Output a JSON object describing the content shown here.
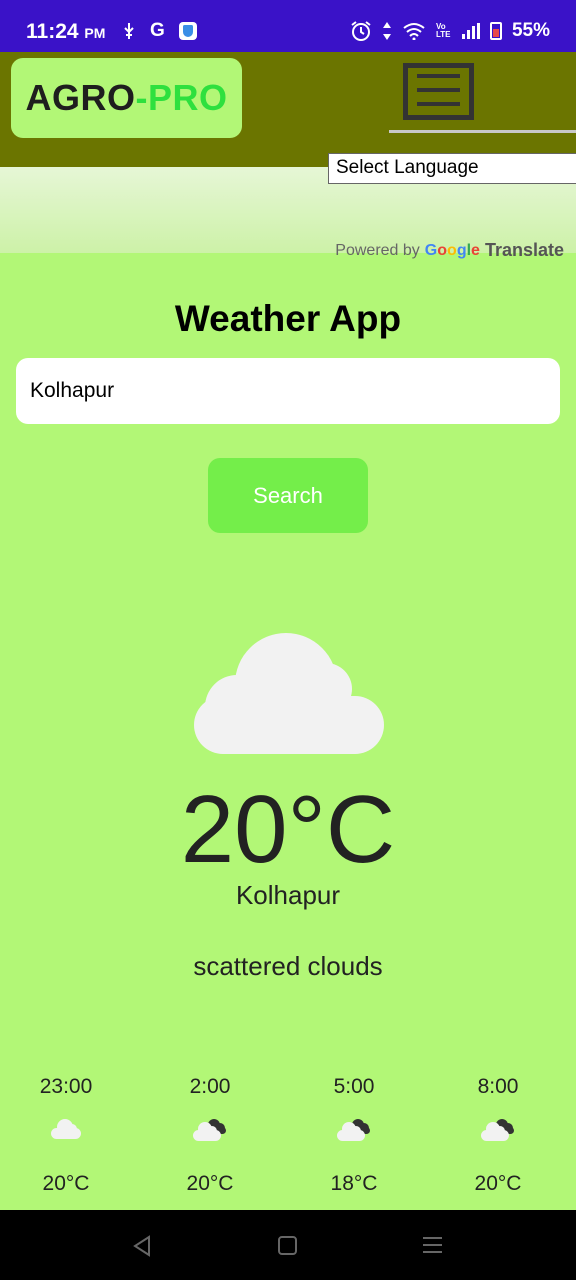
{
  "status_bar": {
    "time": "11:24",
    "ampm": "PM",
    "g_letter": "G",
    "network_label": "Vo LTE",
    "battery": "55%"
  },
  "header": {
    "logo_part1": "AGRO",
    "logo_dash": "-",
    "logo_part2": "PRO",
    "colors": {
      "bar": "#6b7500",
      "logo_bg": "#b2f776",
      "logo_accent": "#2ee03e"
    }
  },
  "translate": {
    "select_value": "Select Language",
    "powered_by": "Powered by",
    "brand": "Google",
    "translate_label": "Translate"
  },
  "main": {
    "title": "Weather App",
    "search_value": "Kolhapur",
    "search_button": "Search",
    "temperature": "20°C",
    "city": "Kolhapur",
    "description": "scattered clouds",
    "main_icon": "cloud-icon",
    "colors": {
      "background": "#b2f776",
      "button": "#74ee4a"
    }
  },
  "forecast": [
    {
      "time": "23:00",
      "temp": "20°C",
      "icon": "cloud-icon"
    },
    {
      "time": "2:00",
      "temp": "20°C",
      "icon": "broken-clouds-icon"
    },
    {
      "time": "5:00",
      "temp": "18°C",
      "icon": "broken-clouds-icon"
    },
    {
      "time": "8:00",
      "temp": "20°C",
      "icon": "broken-clouds-icon"
    }
  ]
}
